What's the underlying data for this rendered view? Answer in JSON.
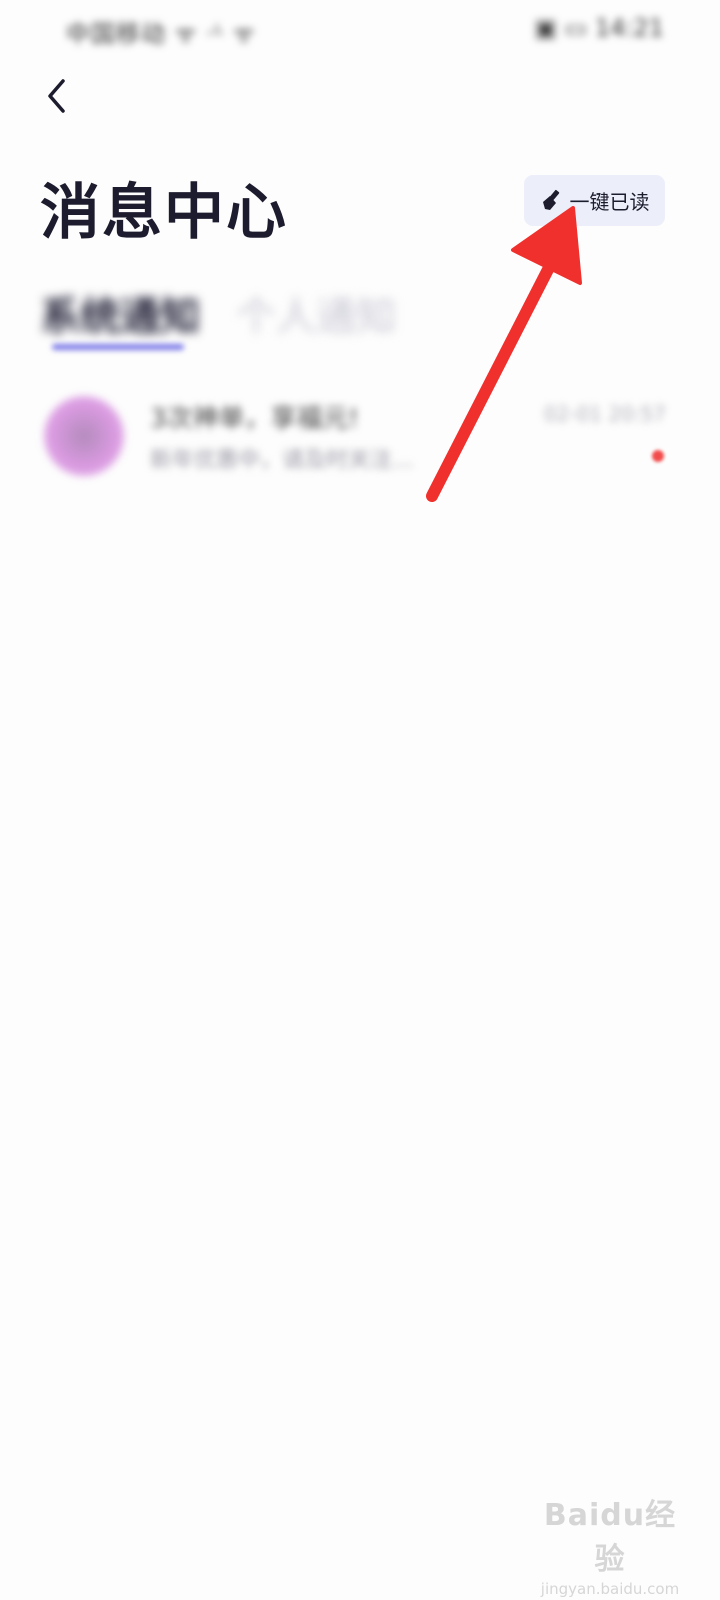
{
  "status_bar": {
    "left_text": "中国移动 ᯤ ‧ᴸ ᯤ",
    "right_text": "▣ ▭ 14:21"
  },
  "header": {
    "title": "消息中心",
    "mark_all_read_label": "一键已读"
  },
  "tabs": [
    {
      "label": "系统通知",
      "active": true
    },
    {
      "label": "个人通知",
      "active": false
    }
  ],
  "messages": [
    {
      "title": "3次神单，享福元!",
      "preview": "新年优惠中，请及时关注…",
      "time": "02-01 20:57",
      "unread": true
    }
  ],
  "watermark": {
    "logo": "Baidu经验",
    "url": "jingyan.baidu.com"
  },
  "colors": {
    "accent": "#7b79e8",
    "button_bg": "#eceef9",
    "annotation_red": "#f0302c",
    "unread_red": "#f24b4b",
    "title_text": "#1c1c2e"
  },
  "icons": {
    "back": "chevron-left-icon",
    "mark_read": "broom-icon"
  }
}
